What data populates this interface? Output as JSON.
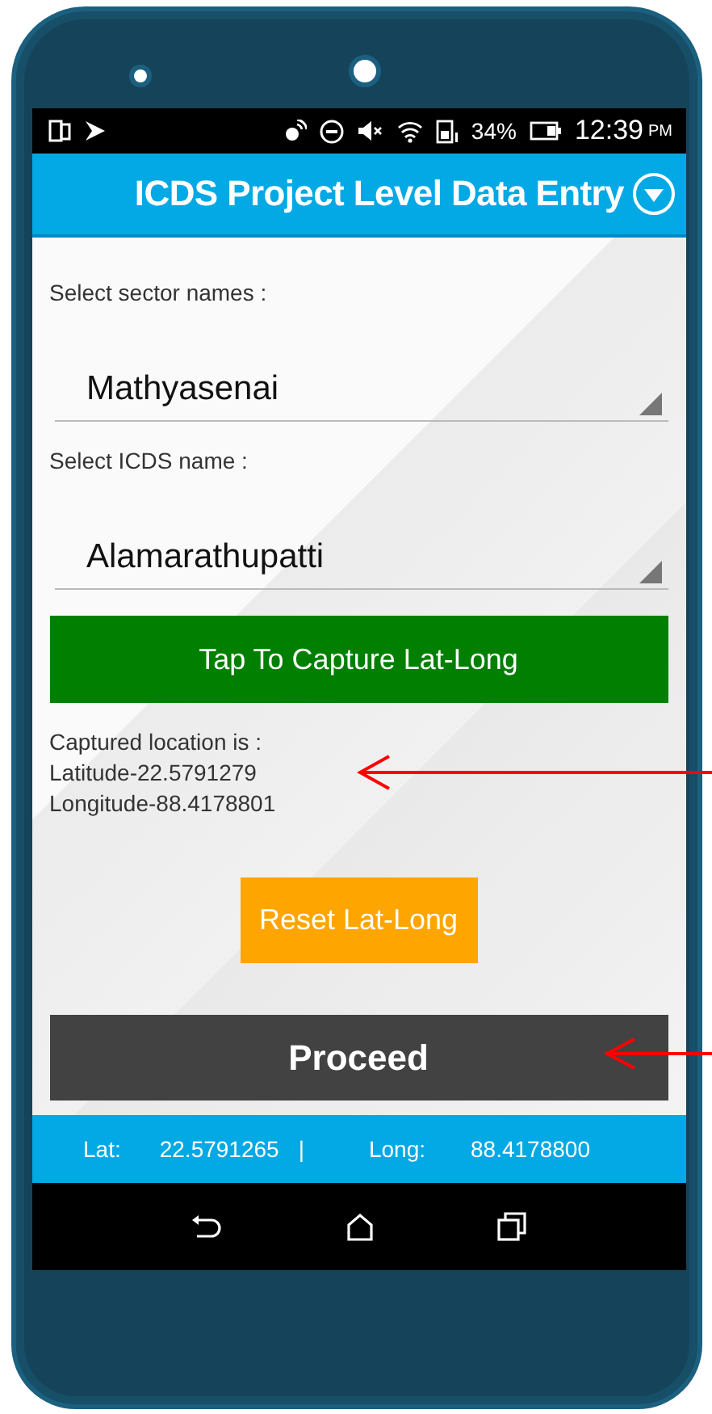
{
  "status_bar": {
    "battery": "34%",
    "time": "12:39",
    "period": "PM"
  },
  "app_bar": {
    "title": "ICDS Project Level Data Entry"
  },
  "form": {
    "fields": [
      {
        "label": "Select sector names :",
        "value": "Mathyasenai"
      },
      {
        "label": "Select ICDS name :",
        "value": "Alamarathupatti"
      }
    ],
    "capture_button": "Tap To Capture Lat-Long",
    "captured": [
      "Captured location is :",
      "Latitude-22.5791279",
      "Longitude-88.4178801"
    ],
    "reset_button": "Reset Lat-Long",
    "proceed_button": "Proceed"
  },
  "footer": {
    "lat_label": "Lat:",
    "lat_value": "22.5791265",
    "separator": "|",
    "long_label": "Long:",
    "long_value": "88.4178800"
  }
}
